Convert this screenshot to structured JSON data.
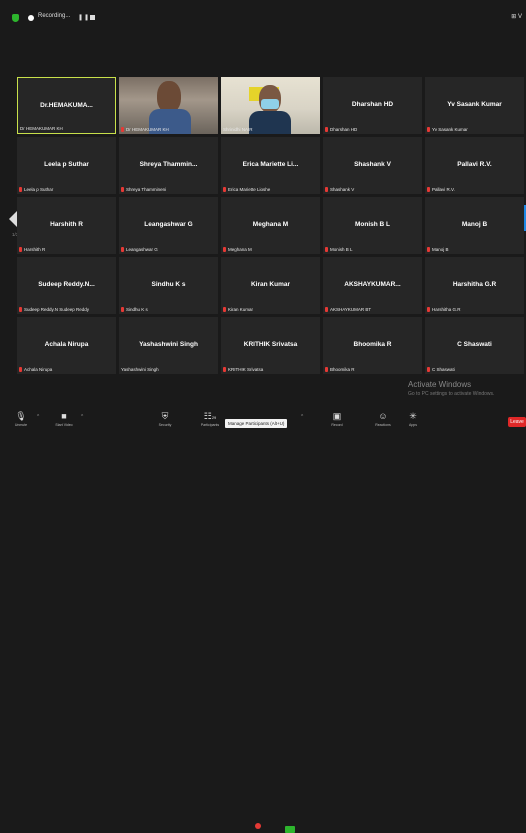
{
  "topbar": {
    "recording_label": "Recording...",
    "pause_symbol": "❚❚",
    "view_label": "⊞ V"
  },
  "tiles": [
    {
      "name": "Dr.HEMAKUMA...",
      "sub": "Dr HEMAKUMAR KH",
      "muted": false
    },
    {
      "name": "",
      "sub": "Dr HEMAKUMAR KH",
      "muted": true,
      "video": true
    },
    {
      "name": "",
      "sub": "Shrinidhi NAIR",
      "muted": false,
      "video": true
    },
    {
      "name": "Dharshan HD",
      "sub": "Dharshan HD",
      "muted": true
    },
    {
      "name": "Yv Sasank Kumar",
      "sub": "Yv Sasank Kumar",
      "muted": true
    },
    {
      "name": "Leela p Suthar",
      "sub": "Leela p Suthar",
      "muted": true
    },
    {
      "name": "Shreya Thammin...",
      "sub": "Shreya Thammineni",
      "muted": true
    },
    {
      "name": "Erica Mariette Li...",
      "sub": "Erica Mariette Lioshe",
      "muted": true
    },
    {
      "name": "Shashank V",
      "sub": "Shashank V",
      "muted": true
    },
    {
      "name": "Pallavi R.V.",
      "sub": "Pallavi R.V.",
      "muted": true
    },
    {
      "name": "Harshith R",
      "sub": "Harshith R",
      "muted": true
    },
    {
      "name": "Leangashwar G",
      "sub": "Leangashwar G",
      "muted": true
    },
    {
      "name": "Meghana M",
      "sub": "Meghana M",
      "muted": true
    },
    {
      "name": "Monish B L",
      "sub": "Monish B L",
      "muted": true
    },
    {
      "name": "Manoj B",
      "sub": "Manoj B",
      "muted": true
    },
    {
      "name": "Sudeep Reddy.N...",
      "sub": "Sudeep Reddy.N Sudeep Reddy",
      "muted": true
    },
    {
      "name": "Sindhu K s",
      "sub": "Sindhu K s",
      "muted": true
    },
    {
      "name": "Kiran Kumar",
      "sub": "Kiran Kumar",
      "muted": true
    },
    {
      "name": "AKSHAYKUMAR...",
      "sub": "AKSHAYKUMAR BT",
      "muted": true
    },
    {
      "name": "Harshitha G.R",
      "sub": "Harshitha G.R",
      "muted": true
    },
    {
      "name": "Achala Nirupa",
      "sub": "Achala Nirupa",
      "muted": true
    },
    {
      "name": "Yashashwini Singh",
      "sub": "Yashashwini Singh",
      "muted": false
    },
    {
      "name": "KRITHIK Srivatsa",
      "sub": "KRITHIK Srivatsa",
      "muted": true
    },
    {
      "name": "Bhoomika R",
      "sub": "Bhoomika R",
      "muted": true
    },
    {
      "name": "C Shaswati",
      "sub": "C Shaswati",
      "muted": true
    }
  ],
  "pager": {
    "left_label": "1/3"
  },
  "watermark": {
    "title": "Activate Windows",
    "subtitle": "Go to PC settings to activate Windows."
  },
  "toolbar": {
    "unmute": {
      "icon": "🎙",
      "label": "Unmute"
    },
    "video": {
      "icon": "■",
      "label": "Start Video"
    },
    "security": {
      "icon": "⛨",
      "label": "Security"
    },
    "participants": {
      "icon": "☷",
      "label": "Participants",
      "count": "29"
    },
    "chat": {
      "icon": "▭",
      "label": "Chat"
    },
    "share": {
      "icon": "↑",
      "label": "Share Screen"
    },
    "record": {
      "icon": "▣",
      "label": "Record"
    },
    "reactions": {
      "icon": "☺",
      "label": "Reactions"
    },
    "apps": {
      "icon": "✳",
      "label": "Apps"
    },
    "tooltip": "Manage Participants (Alt+U)",
    "leave": "Leave"
  },
  "colors": {
    "active_border": "#c8e04a",
    "mute_red": "#e53935",
    "leave_red": "#e02828",
    "shield_green": "#2db52d"
  }
}
